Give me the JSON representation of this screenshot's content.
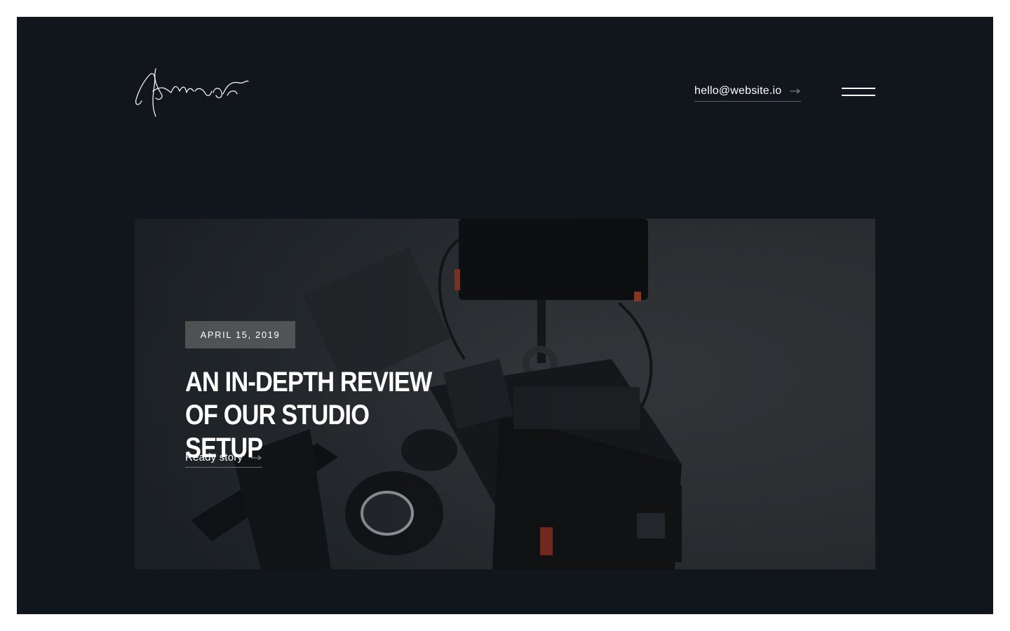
{
  "header": {
    "logo_alt": "signature logo",
    "email": "hello@website.io",
    "email_arrow_icon": "arrow-right-icon",
    "menu_icon": "hamburger-menu-icon"
  },
  "hero": {
    "date": "APRIL 15, 2019",
    "title": "AN IN-DEPTH REVIEW OF OUR STUDIO SETUP",
    "cta_label": "Ready story",
    "cta_arrow_icon": "arrow-right-icon"
  },
  "colors": {
    "page_background": "#10161b",
    "hero_background": "#303336",
    "text": "#ffffff",
    "underline": "#5b6066"
  }
}
